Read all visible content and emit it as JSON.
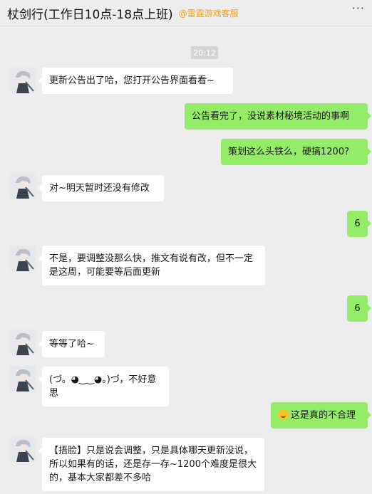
{
  "header": {
    "title": "杖剑行(工作日10点-18点上班)",
    "tag": "@雷霆游戏客服",
    "more_icon": "more-icon"
  },
  "timestamp": "20:12",
  "messages": [
    {
      "side": "left",
      "text": "更新公告出了哈，您打开公告界面看看~"
    },
    {
      "side": "right",
      "text": "公告看完了，没说素材秘境活动的事啊"
    },
    {
      "side": "right",
      "text": "策划这么头铁么，硬搞1200?"
    },
    {
      "side": "left",
      "text": "对~明天暂时还没有修改"
    },
    {
      "side": "right",
      "text": "6"
    },
    {
      "side": "left",
      "text": "不是，要调整没那么快，推文有说有改，但不一定是这周，可能要等后面更新"
    },
    {
      "side": "right",
      "text": "6"
    },
    {
      "side": "left",
      "text": "等等了哈~"
    },
    {
      "side": "left",
      "text": "(づ。◕‿‿◕。)づ，不好意思"
    },
    {
      "side": "right",
      "text": "这是真的不合理",
      "emoji": "laughing-crying-emoji"
    },
    {
      "side": "left",
      "text": "【捂脸】只是说会调整，只是具体哪天更新没说，所以如果有的话，还是存一存~1200个难度是很大的，基本大家都差不多哈"
    }
  ],
  "colors": {
    "background": "#ededed",
    "incoming_bubble": "#ffffff",
    "outgoing_bubble": "#95ec69",
    "tag": "#f0a020"
  }
}
